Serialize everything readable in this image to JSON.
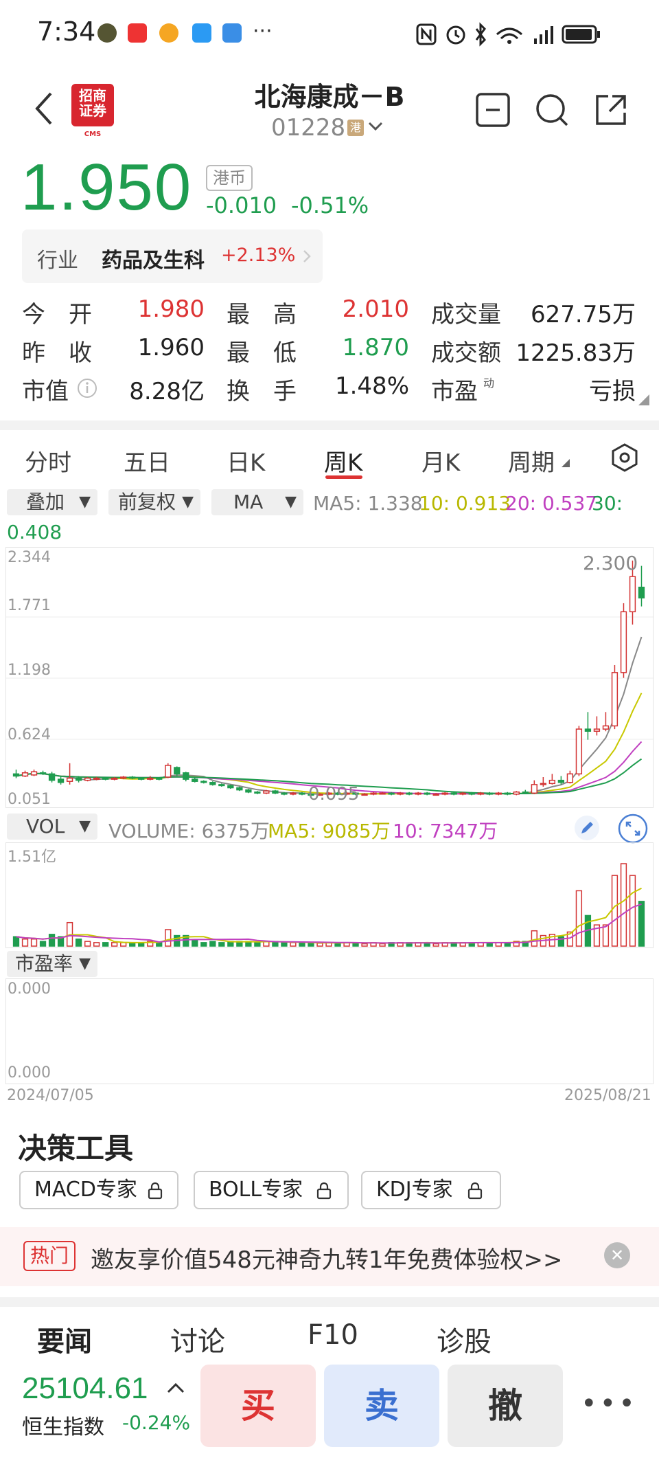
{
  "status_bar": {
    "time": "7:34",
    "more": "···"
  },
  "header": {
    "broker_logo": "招商\n证券",
    "broker_logo_sub": "CMS",
    "title": "北海康成－B",
    "code": "01228",
    "market_badge": "港"
  },
  "quote": {
    "price": "1.950",
    "currency": "港币",
    "change": "-0.010",
    "change_pct": "-0.51%",
    "industry_label": "行业",
    "industry_name": "药品及生科",
    "industry_pct": "+2.13%",
    "rows": [
      {
        "l1": "今　开",
        "v1": "1.980",
        "l2": "最　高",
        "v2": "2.010",
        "l3": "成交量",
        "v3": "627.75万"
      },
      {
        "l1": "昨　收",
        "v1": "1.960",
        "l2": "最　低",
        "v2": "1.870",
        "l3": "成交额",
        "v3": "1225.83万"
      },
      {
        "l1": "市值",
        "v1": "8.28亿",
        "l2": "换　手",
        "v2": "1.48%",
        "l3": "市盈",
        "l3_sup": "动",
        "v3": "亏损"
      }
    ]
  },
  "tabs": [
    "分时",
    "五日",
    "日K",
    "周K",
    "月K",
    "周期"
  ],
  "active_tab": "周K",
  "controls": {
    "overlay": "叠加",
    "adjust": "前复权",
    "indicator": "MA",
    "ma5": "MA5: 1.338",
    "ma10": "10: 0.913",
    "ma20": "20: 0.537",
    "ma30_label": "30:",
    "ma30_val": "0.408"
  },
  "chart": {
    "y_labels": [
      "2.344",
      "1.771",
      "1.198",
      "0.624",
      "0.051"
    ],
    "high_label": "2.300",
    "low_label": "0.095"
  },
  "volume": {
    "selector": "VOL",
    "volume": "VOLUME: 6375万",
    "ma5": "MA5: 9085万",
    "ma10": "10: 7347万",
    "max_label": "1.51亿"
  },
  "pe": {
    "selector": "市盈率",
    "top": "0.000",
    "bottom": "0.000"
  },
  "dates": {
    "start": "2024/07/05",
    "end": "2025/08/21"
  },
  "tools": {
    "title": "决策工具",
    "items": [
      "MACD专家",
      "BOLL专家",
      "KDJ专家"
    ]
  },
  "promo": {
    "tag": "热门",
    "text": "邀友享价值548元神奇九转1年免费体验权>>",
    "close": "✕"
  },
  "bottom_tabs": [
    "要闻",
    "讨论",
    "F10",
    "诊股"
  ],
  "index": {
    "value": "25104.61",
    "name": "恒生指数",
    "pct": "-0.24%"
  },
  "actions": {
    "buy": "买",
    "sell": "卖",
    "cancel": "撤",
    "more": "•••"
  },
  "colors": {
    "up": "#d33333",
    "down": "#1f9d4f",
    "ma5": "#888888",
    "ma10": "#c8c800",
    "ma20": "#c040c0",
    "ma30": "#1f9d4f"
  },
  "chart_data": {
    "type": "candlestick",
    "ylim": [
      0.051,
      2.344
    ],
    "x_range": [
      "2024/07/05",
      "2025/08/21"
    ],
    "candles": [
      {
        "o": 0.3,
        "c": 0.28,
        "h": 0.34,
        "l": 0.26
      },
      {
        "o": 0.28,
        "c": 0.31,
        "h": 0.33,
        "l": 0.27
      },
      {
        "o": 0.29,
        "c": 0.32,
        "h": 0.34,
        "l": 0.28
      },
      {
        "o": 0.31,
        "c": 0.3,
        "h": 0.33,
        "l": 0.29
      },
      {
        "o": 0.3,
        "c": 0.24,
        "h": 0.32,
        "l": 0.22
      },
      {
        "o": 0.25,
        "c": 0.22,
        "h": 0.28,
        "l": 0.2
      },
      {
        "o": 0.23,
        "c": 0.26,
        "h": 0.4,
        "l": 0.2
      },
      {
        "o": 0.26,
        "c": 0.24,
        "h": 0.28,
        "l": 0.22
      },
      {
        "o": 0.24,
        "c": 0.26,
        "h": 0.27,
        "l": 0.23
      },
      {
        "o": 0.25,
        "c": 0.26,
        "h": 0.27,
        "l": 0.24
      },
      {
        "o": 0.26,
        "c": 0.25,
        "h": 0.27,
        "l": 0.24
      },
      {
        "o": 0.25,
        "c": 0.26,
        "h": 0.27,
        "l": 0.24
      },
      {
        "o": 0.26,
        "c": 0.27,
        "h": 0.28,
        "l": 0.25
      },
      {
        "o": 0.27,
        "c": 0.26,
        "h": 0.28,
        "l": 0.25
      },
      {
        "o": 0.26,
        "c": 0.25,
        "h": 0.27,
        "l": 0.24
      },
      {
        "o": 0.25,
        "c": 0.26,
        "h": 0.28,
        "l": 0.24
      },
      {
        "o": 0.26,
        "c": 0.25,
        "h": 0.27,
        "l": 0.24
      },
      {
        "o": 0.27,
        "c": 0.38,
        "h": 0.4,
        "l": 0.26
      },
      {
        "o": 0.36,
        "c": 0.3,
        "h": 0.37,
        "l": 0.28
      },
      {
        "o": 0.31,
        "c": 0.25,
        "h": 0.32,
        "l": 0.23
      },
      {
        "o": 0.25,
        "c": 0.23,
        "h": 0.27,
        "l": 0.22
      },
      {
        "o": 0.23,
        "c": 0.22,
        "h": 0.24,
        "l": 0.21
      },
      {
        "o": 0.22,
        "c": 0.2,
        "h": 0.23,
        "l": 0.19
      },
      {
        "o": 0.2,
        "c": 0.19,
        "h": 0.21,
        "l": 0.18
      },
      {
        "o": 0.19,
        "c": 0.17,
        "h": 0.2,
        "l": 0.16
      },
      {
        "o": 0.17,
        "c": 0.15,
        "h": 0.18,
        "l": 0.14
      },
      {
        "o": 0.15,
        "c": 0.13,
        "h": 0.16,
        "l": 0.12
      },
      {
        "o": 0.13,
        "c": 0.12,
        "h": 0.14,
        "l": 0.11
      },
      {
        "o": 0.12,
        "c": 0.14,
        "h": 0.15,
        "l": 0.11
      },
      {
        "o": 0.14,
        "c": 0.12,
        "h": 0.15,
        "l": 0.11
      },
      {
        "o": 0.12,
        "c": 0.11,
        "h": 0.13,
        "l": 0.1
      },
      {
        "o": 0.11,
        "c": 0.12,
        "h": 0.13,
        "l": 0.1
      },
      {
        "o": 0.12,
        "c": 0.11,
        "h": 0.13,
        "l": 0.1
      },
      {
        "o": 0.11,
        "c": 0.1,
        "h": 0.12,
        "l": 0.095
      },
      {
        "o": 0.1,
        "c": 0.11,
        "h": 0.12,
        "l": 0.095
      },
      {
        "o": 0.11,
        "c": 0.12,
        "h": 0.13,
        "l": 0.1
      },
      {
        "o": 0.12,
        "c": 0.11,
        "h": 0.13,
        "l": 0.1
      },
      {
        "o": 0.11,
        "c": 0.12,
        "h": 0.13,
        "l": 0.1
      },
      {
        "o": 0.12,
        "c": 0.11,
        "h": 0.13,
        "l": 0.1
      },
      {
        "o": 0.11,
        "c": 0.11,
        "h": 0.12,
        "l": 0.1
      },
      {
        "o": 0.11,
        "c": 0.12,
        "h": 0.13,
        "l": 0.1
      },
      {
        "o": 0.12,
        "c": 0.12,
        "h": 0.13,
        "l": 0.11
      },
      {
        "o": 0.12,
        "c": 0.11,
        "h": 0.13,
        "l": 0.1
      },
      {
        "o": 0.11,
        "c": 0.12,
        "h": 0.13,
        "l": 0.1
      },
      {
        "o": 0.12,
        "c": 0.11,
        "h": 0.13,
        "l": 0.1
      },
      {
        "o": 0.11,
        "c": 0.12,
        "h": 0.13,
        "l": 0.1
      },
      {
        "o": 0.12,
        "c": 0.11,
        "h": 0.13,
        "l": 0.1
      },
      {
        "o": 0.11,
        "c": 0.11,
        "h": 0.12,
        "l": 0.1
      },
      {
        "o": 0.11,
        "c": 0.12,
        "h": 0.13,
        "l": 0.1
      },
      {
        "o": 0.12,
        "c": 0.11,
        "h": 0.13,
        "l": 0.1
      },
      {
        "o": 0.11,
        "c": 0.12,
        "h": 0.13,
        "l": 0.1
      },
      {
        "o": 0.12,
        "c": 0.11,
        "h": 0.13,
        "l": 0.1
      },
      {
        "o": 0.11,
        "c": 0.12,
        "h": 0.13,
        "l": 0.1
      },
      {
        "o": 0.12,
        "c": 0.11,
        "h": 0.13,
        "l": 0.1
      },
      {
        "o": 0.11,
        "c": 0.12,
        "h": 0.13,
        "l": 0.1
      },
      {
        "o": 0.12,
        "c": 0.11,
        "h": 0.13,
        "l": 0.1
      },
      {
        "o": 0.11,
        "c": 0.13,
        "h": 0.14,
        "l": 0.1
      },
      {
        "o": 0.13,
        "c": 0.12,
        "h": 0.15,
        "l": 0.11
      },
      {
        "o": 0.12,
        "c": 0.2,
        "h": 0.24,
        "l": 0.11
      },
      {
        "o": 0.2,
        "c": 0.21,
        "h": 0.27,
        "l": 0.18
      },
      {
        "o": 0.21,
        "c": 0.24,
        "h": 0.3,
        "l": 0.2
      },
      {
        "o": 0.24,
        "c": 0.22,
        "h": 0.28,
        "l": 0.2
      },
      {
        "o": 0.22,
        "c": 0.3,
        "h": 0.33,
        "l": 0.21
      },
      {
        "o": 0.3,
        "c": 0.72,
        "h": 0.75,
        "l": 0.28
      },
      {
        "o": 0.72,
        "c": 0.7,
        "h": 0.88,
        "l": 0.62
      },
      {
        "o": 0.7,
        "c": 0.72,
        "h": 0.84,
        "l": 0.66
      },
      {
        "o": 0.72,
        "c": 0.75,
        "h": 0.88,
        "l": 0.7
      },
      {
        "o": 0.75,
        "c": 1.25,
        "h": 1.32,
        "l": 0.72
      },
      {
        "o": 1.25,
        "c": 1.82,
        "h": 1.9,
        "l": 1.2
      },
      {
        "o": 1.82,
        "c": 2.15,
        "h": 2.3,
        "l": 1.7
      },
      {
        "o": 2.05,
        "c": 1.95,
        "h": 2.25,
        "l": 1.87
      }
    ],
    "volume_max": "1.51亿"
  }
}
